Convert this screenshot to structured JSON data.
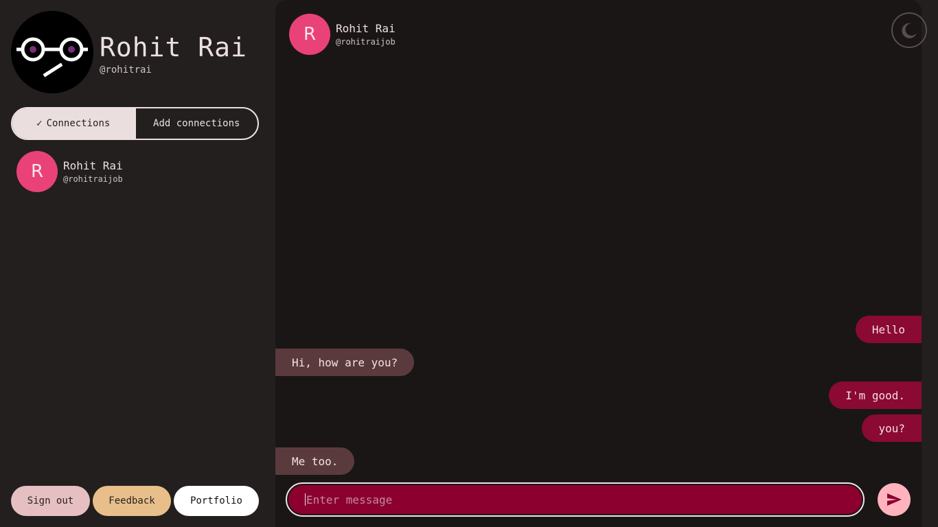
{
  "profile": {
    "name": "Rohit Rai",
    "handle": "@rohitrai",
    "avatar_icon": "glasses-face-icon"
  },
  "tabs": {
    "connections": "Connections",
    "add_connections": "Add connections",
    "active": "connections"
  },
  "connections": [
    {
      "initial": "R",
      "name": "Rohit Rai",
      "handle": "@rohitraijob"
    }
  ],
  "bottom_buttons": {
    "sign_out": "Sign out",
    "feedback": "Feedback",
    "portfolio": "Portfolio"
  },
  "chat": {
    "header": {
      "initial": "R",
      "name": "Rohit Rai",
      "handle": "@rohitraijob"
    },
    "messages": [
      {
        "from": "me",
        "text": "Hello"
      },
      {
        "from": "them",
        "text": "Hi, how are you?"
      },
      {
        "from": "me",
        "text": "I'm good."
      },
      {
        "from": "me",
        "text": "you?"
      },
      {
        "from": "them",
        "text": "Me too."
      }
    ],
    "input_placeholder": "Enter message",
    "input_value": ""
  },
  "colors": {
    "accent": "#e94278",
    "sent_bubble": "#8a0a33",
    "received_bubble": "#5b3a3d",
    "composer": "#8c0030",
    "send_button": "#ffb3bd"
  }
}
